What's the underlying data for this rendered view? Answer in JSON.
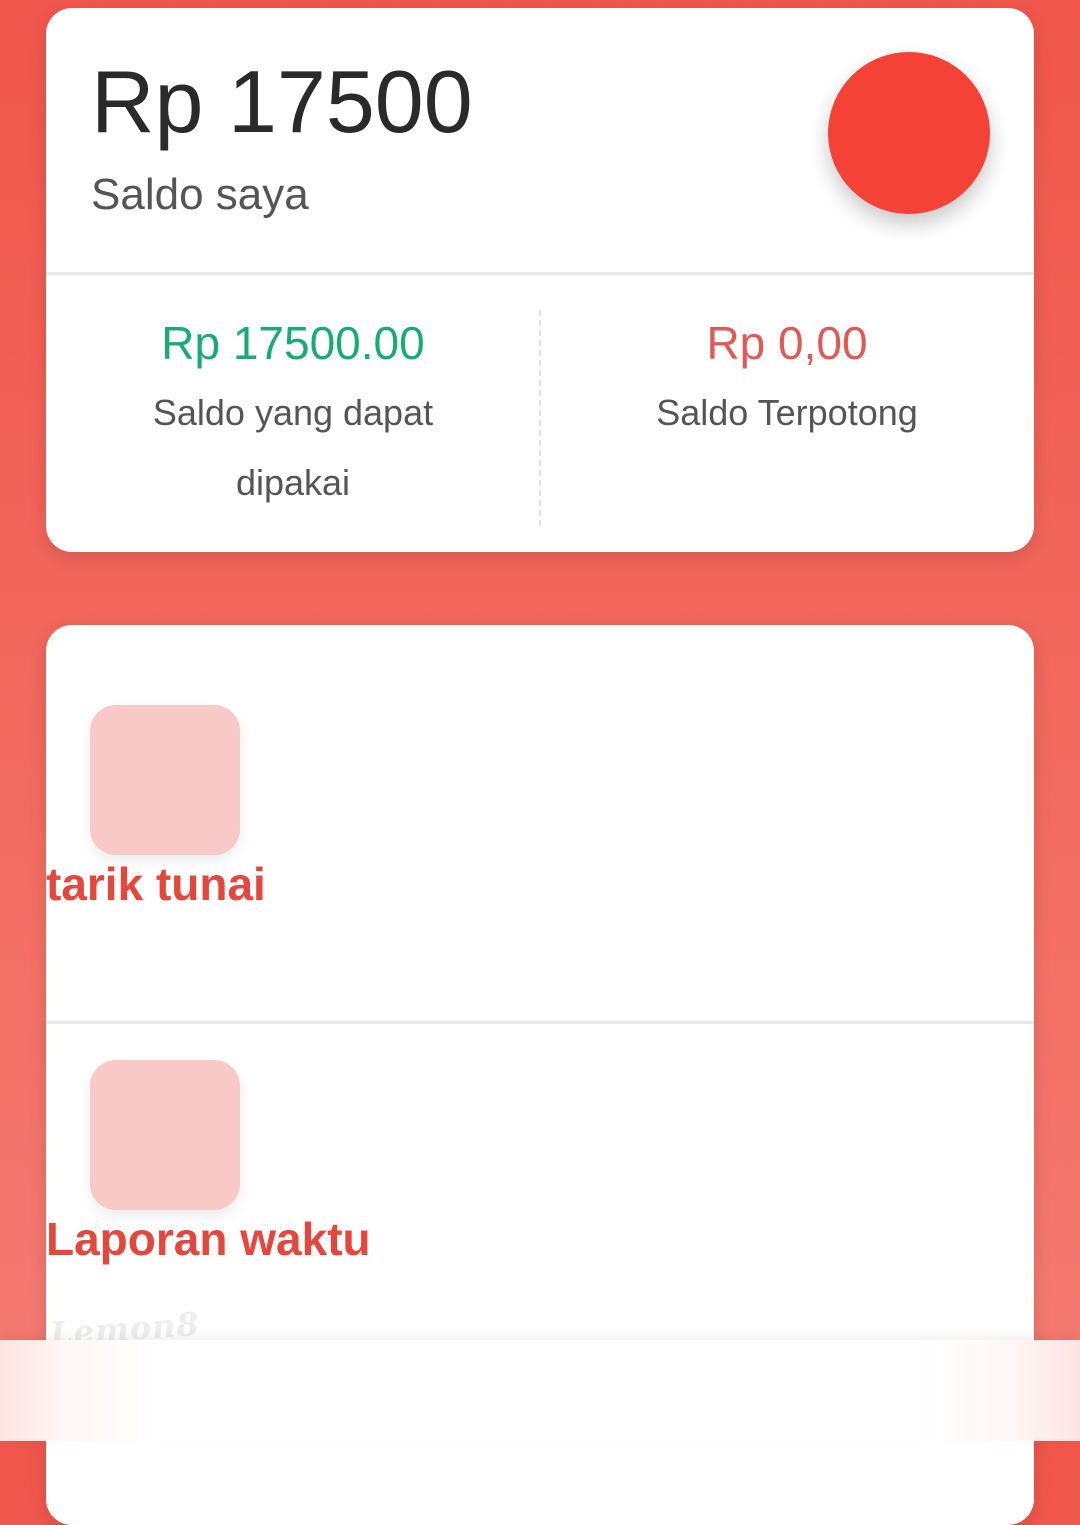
{
  "balance": {
    "amount": "Rp 17500",
    "label": "Saldo saya"
  },
  "stats": {
    "available_value": "Rp 17500.00",
    "available_label": "Saldo yang dapat dipakai",
    "deducted_value": "Rp 0,00",
    "deducted_label": "Saldo Terpotong"
  },
  "menu": {
    "items": [
      {
        "label": "tarik tunai"
      },
      {
        "label": "Laporan waktu"
      }
    ]
  },
  "watermark": "Lemon8",
  "colors": {
    "background": "#f0564b",
    "accent": "#f44336",
    "positive": "#1aaa75",
    "negative": "#e05a55",
    "menu_label": "#e2483d",
    "icon_tile": "#f8c9c6"
  }
}
